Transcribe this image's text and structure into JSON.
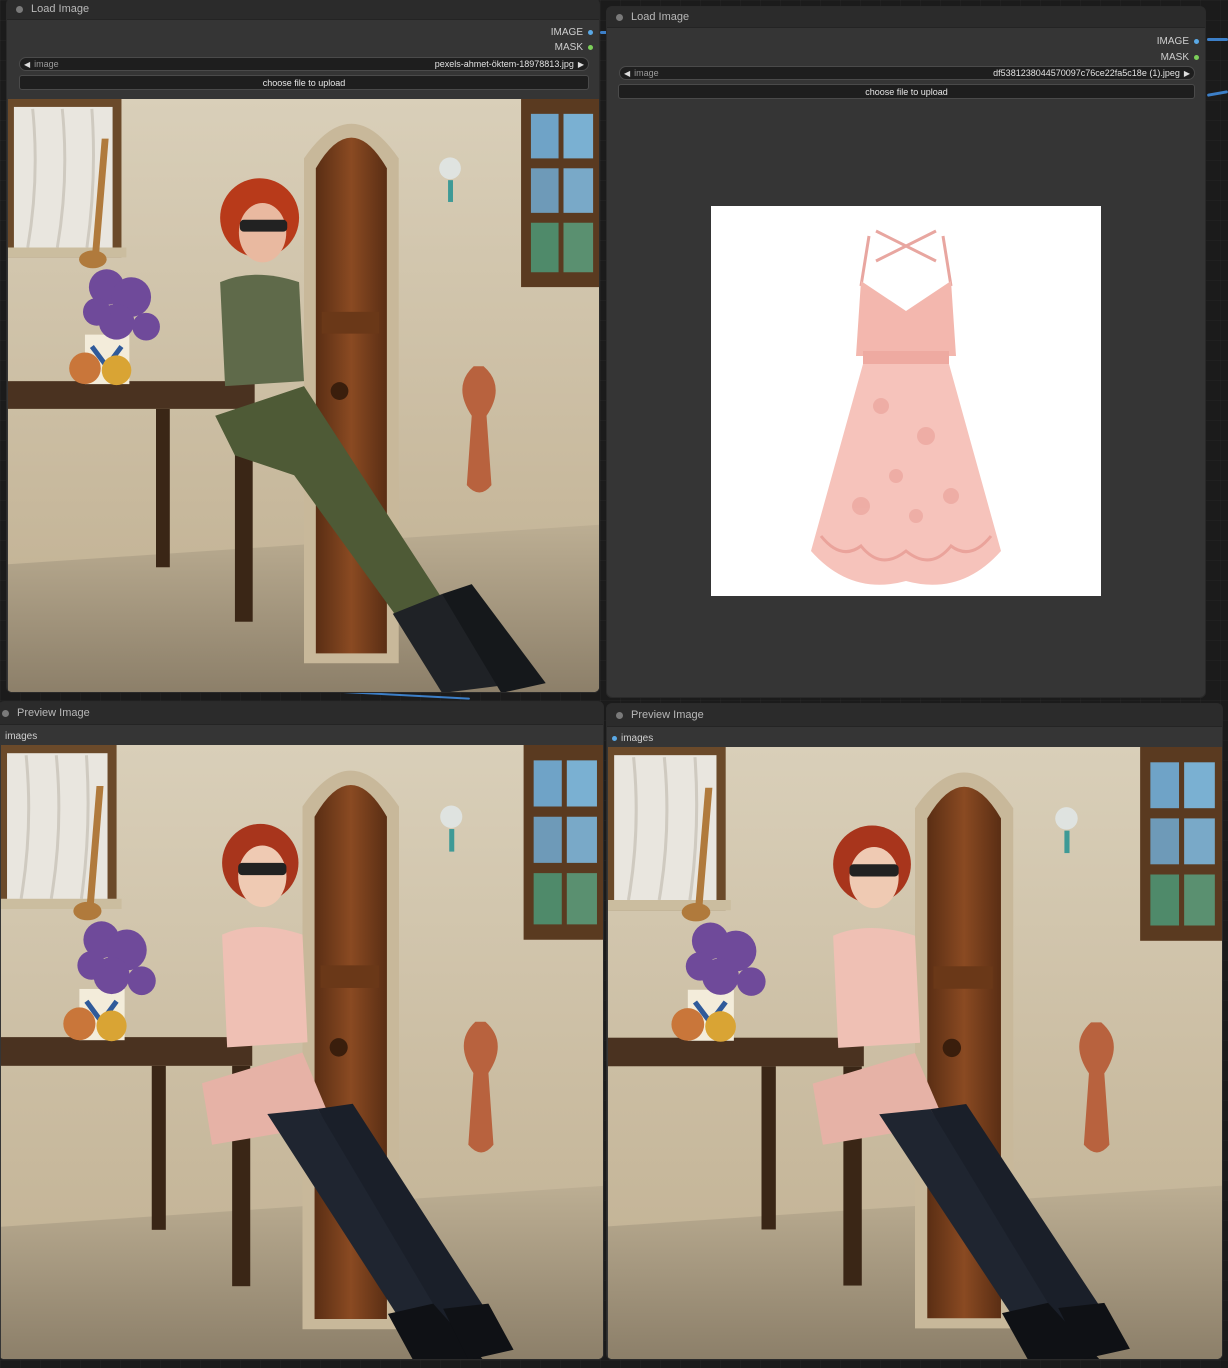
{
  "nodes": {
    "load_person": {
      "title": "Load Image",
      "outputs": {
        "image": "IMAGE",
        "mask": "MASK"
      },
      "image_widget": {
        "label": "image",
        "value": "pexels-ahmet-öktem-18978813.jpg"
      },
      "upload_label": "choose file to upload"
    },
    "load_garment": {
      "title": "Load Image",
      "outputs": {
        "image": "IMAGE",
        "mask": "MASK"
      },
      "image_widget": {
        "label": "image",
        "value": "df5381238044570097c76ce22fa5c18e (1).jpeg"
      },
      "upload_label": "choose file to upload"
    },
    "preview_left": {
      "title": "Preview Image",
      "input_label": "images"
    },
    "preview_right": {
      "title": "Preview Image",
      "input_label": "images"
    }
  },
  "colors": {
    "node_bg": "#353535",
    "title_bg": "#2b2b2b",
    "image_port": "#5aa9e6",
    "mask_port": "#7ccf5a",
    "link": "#3c7fc8"
  }
}
